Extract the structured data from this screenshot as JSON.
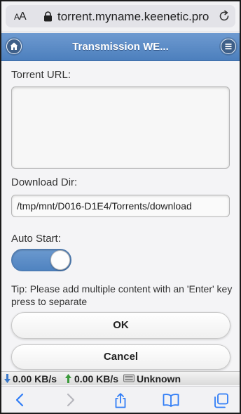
{
  "browser": {
    "aa_small": "A",
    "aa_large": "A",
    "url": "torrent.myname.keenetic.pro"
  },
  "header": {
    "title": "Transmission WE..."
  },
  "form": {
    "torrent_url_label": "Torrent URL:",
    "torrent_url_value": "",
    "download_dir_label": "Download Dir:",
    "download_dir_value": "/tmp/mnt/D016-D1E4/Torrents/download",
    "auto_start_label": "Auto Start:",
    "auto_start_on": true,
    "tip": "Tip: Please add multiple content with an 'Enter' key press to separate",
    "ok_label": "OK",
    "cancel_label": "Cancel"
  },
  "status": {
    "down_speed": "0.00 KB/s",
    "up_speed": "0.00 KB/s",
    "disk": "Unknown"
  },
  "icons": {
    "lock": "lock-icon",
    "reload": "reload-icon",
    "home": "home-icon",
    "menu": "menu-icon",
    "down_arrow": "download-arrow-icon",
    "up_arrow": "upload-arrow-icon",
    "disk": "disk-icon",
    "back": "back-icon",
    "forward": "forward-icon",
    "share": "share-icon",
    "bookmarks": "bookmarks-icon",
    "tabs": "tabs-icon"
  },
  "colors": {
    "accent": "#4c7fbd",
    "toolbar_icon": "#2f7cf6",
    "up_arrow": "#3b9a3b",
    "down_arrow": "#3a78c9"
  }
}
